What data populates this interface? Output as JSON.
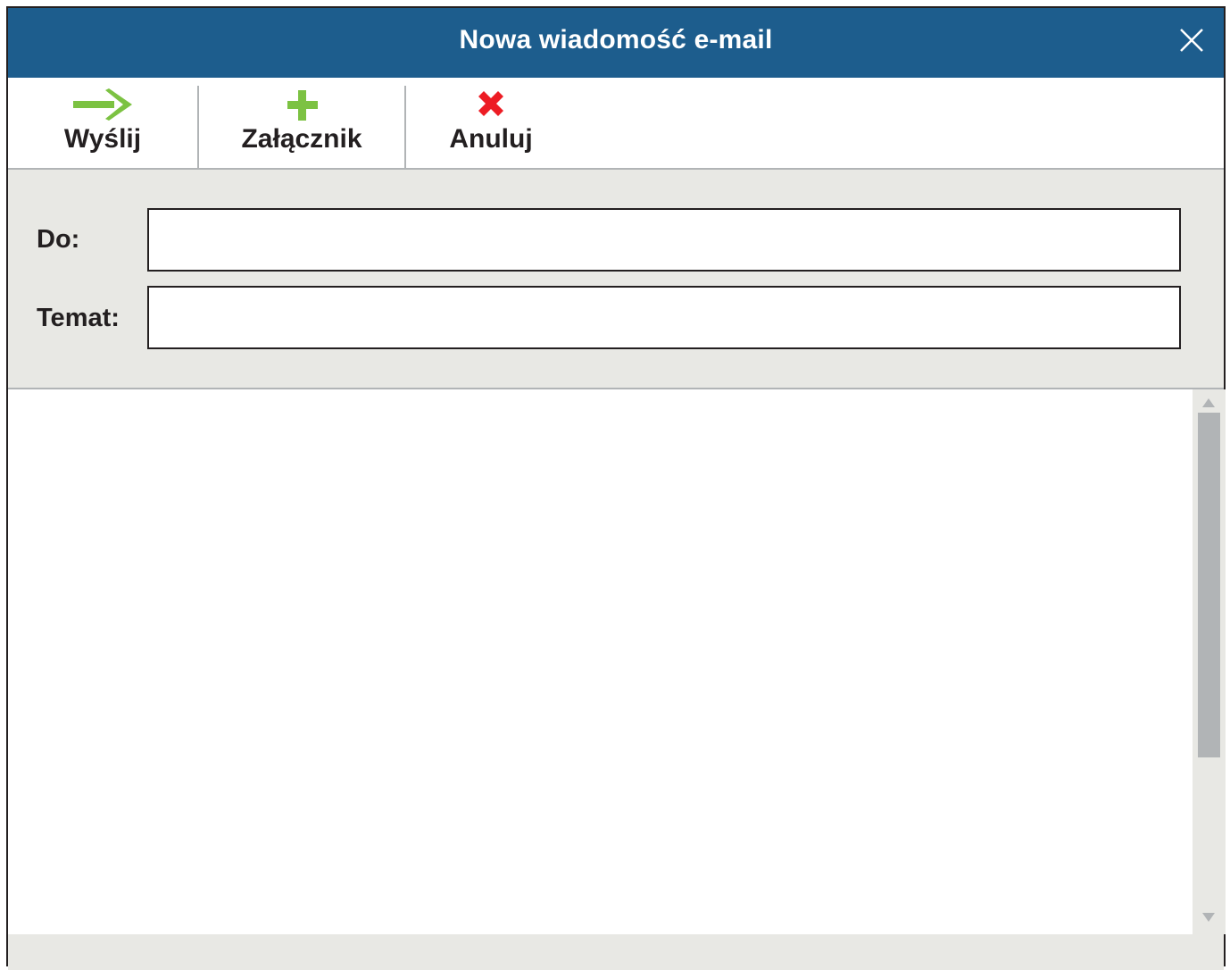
{
  "window": {
    "title": "Nowa wiadomość e-mail"
  },
  "toolbar": {
    "send_label": "Wyślij",
    "attach_label": "Załącznik",
    "cancel_label": "Anuluj"
  },
  "fields": {
    "to_label": "Do:",
    "to_value": "",
    "subject_label": "Temat:",
    "subject_value": ""
  },
  "body": {
    "text": ""
  },
  "icons": {
    "send": "arrow-right-icon",
    "attach": "plus-icon",
    "cancel": "cross-icon",
    "close": "close-icon"
  },
  "colors": {
    "titlebar": "#1d5d8d",
    "send_icon": "#7cc242",
    "attach_icon": "#7cc242",
    "cancel_icon": "#ed1c24",
    "panel_bg": "#e8e8e4",
    "scroll_thumb": "#b1b4b6"
  }
}
